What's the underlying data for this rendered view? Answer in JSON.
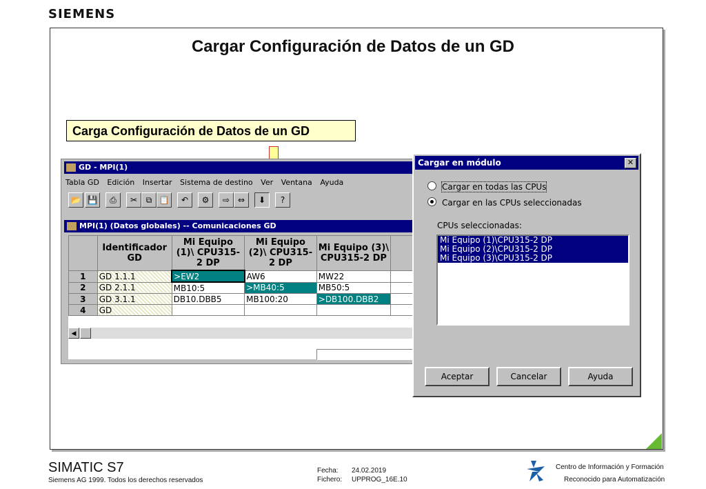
{
  "brand": "SIEMENS",
  "slide_title": "Cargar Configuración de Datos de un GD",
  "callout": "Carga Configuración de Datos de un GD",
  "gd_window": {
    "title": "GD - MPI(1)",
    "menu": [
      "Tabla GD",
      "Edición",
      "Insertar",
      "Sistema de destino",
      "Ver",
      "Ventana",
      "Ayuda"
    ],
    "toolbar_icons": [
      "open-icon",
      "save-icon",
      "print-icon",
      "cut-icon",
      "copy-icon",
      "paste-icon",
      "undo-icon",
      "compile-icon",
      "read-icon",
      "monitor-icon",
      "download-icon",
      "help-icon"
    ],
    "sub_title": "MPI(1) (Datos globales) -- Comunicaciones GD",
    "columns": [
      "Identificador GD",
      "Mi Equipo (1)\\ CPU315-2 DP",
      "Mi Equipo (2)\\ CPU315-2 DP",
      "Mi Equipo (3)\\ CPU315-2 DP"
    ],
    "rows": [
      {
        "num": "1",
        "id": "GD 1.1.1",
        "c1": ">EW2",
        "c2": "AW6",
        "c3": "MW22"
      },
      {
        "num": "2",
        "id": "GD 2.1.1",
        "c1": "MB10:5",
        "c2": ">MB40:5",
        "c3": "MB50:5"
      },
      {
        "num": "3",
        "id": "GD 3.1.1",
        "c1": "DB10.DBB5",
        "c2": "MB100:20",
        "c3": ">DB100.DBB2"
      },
      {
        "num": "4",
        "id": "GD",
        "c1": "",
        "c2": "",
        "c3": ""
      }
    ]
  },
  "dialog": {
    "title": "Cargar en módulo",
    "close": "✕",
    "radio_all": "Cargar en todas las CPUs",
    "radio_selected": "Cargar en las CPUs seleccionadas",
    "list_label": "CPUs seleccionadas:",
    "list_items": [
      "Mi Equipo (1)\\CPU315-2 DP",
      "Mi Equipo (2)\\CPU315-2 DP",
      "Mi Equipo (3)\\CPU315-2 DP"
    ],
    "btn_ok": "Aceptar",
    "btn_cancel": "Cancelar",
    "btn_help": "Ayuda"
  },
  "footer": {
    "product": "SIMATIC S7",
    "copyright": "Siemens AG 1999. Todos los derechos reservados",
    "fecha_label": "Fecha:",
    "fecha": "24.02.2019",
    "fichero_label": "Fichero:",
    "fichero": "UPPROG_16E.10",
    "center": "Centro de Información y Formación",
    "recognized": "Reconocido para Automatización"
  }
}
